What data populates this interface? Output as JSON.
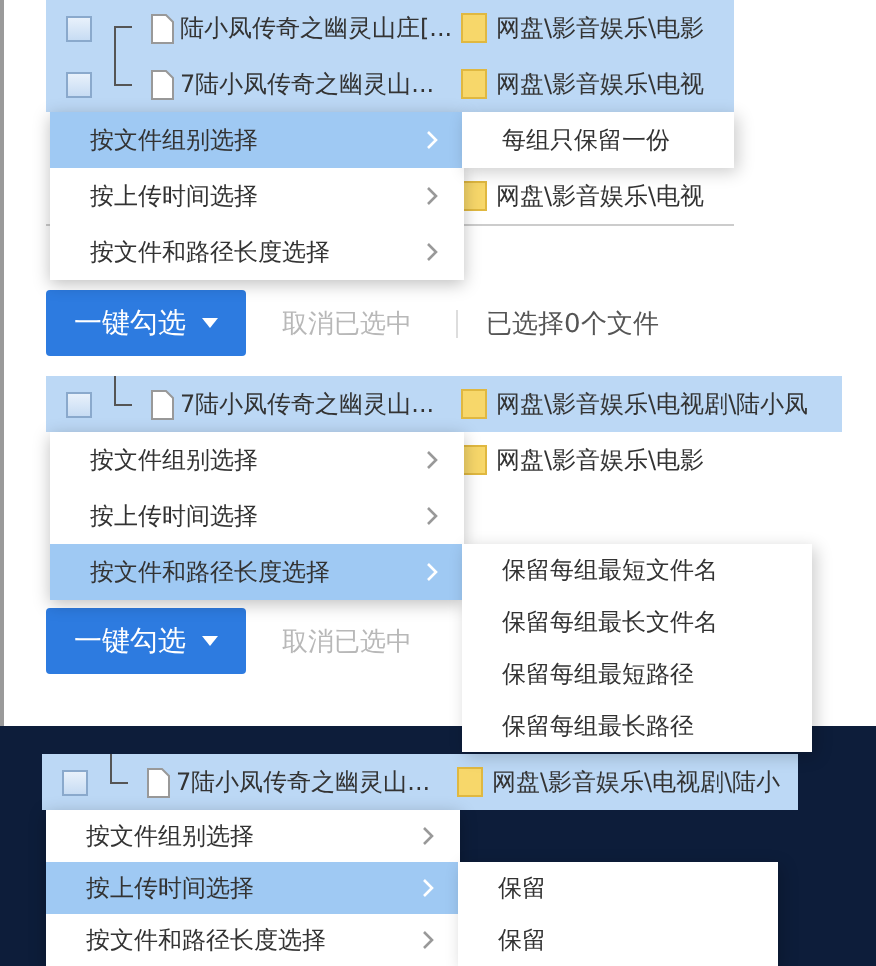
{
  "panels": [
    {
      "kind": "light",
      "rows": [
        {
          "selected": true,
          "kind": "tree-first",
          "file": "陆小凤传奇之幽灵山庄[...",
          "path": "网盘\\影音娱乐\\电影"
        },
        {
          "selected": true,
          "kind": "tree-last",
          "file": "7陆小凤传奇之幽灵山...",
          "path": "网盘\\影音娱乐\\电视"
        },
        {
          "selected": false,
          "kind": "plain",
          "path": "网盘\\影音娱乐\\电视"
        }
      ],
      "menu": {
        "items": [
          {
            "label": "按文件组别选择",
            "selected": true
          },
          {
            "label": "按上传时间选择",
            "selected": false
          },
          {
            "label": "按文件和路径长度选择",
            "selected": false
          }
        ],
        "submenu": [
          "每组只保留一份"
        ]
      },
      "footer": {
        "button": "一键勾选",
        "cancel": "取消已选中",
        "status": "已选择0个文件"
      }
    },
    {
      "kind": "light",
      "rows": [
        {
          "selected": true,
          "kind": "tree-last",
          "file": "7陆小凤传奇之幽灵山...",
          "path": "网盘\\影音娱乐\\电视剧\\陆小凤"
        },
        {
          "selected": false,
          "kind": "plain",
          "path": "网盘\\影音娱乐\\电影"
        }
      ],
      "menu": {
        "items": [
          {
            "label": "按文件组别选择",
            "selected": false
          },
          {
            "label": "按上传时间选择",
            "selected": false
          },
          {
            "label": "按文件和路径长度选择",
            "selected": true
          }
        ],
        "submenu": [
          "保留每组最短文件名",
          "保留每组最长文件名",
          "保留每组最短路径",
          "保留每组最长路径"
        ]
      },
      "footer": {
        "button": "一键勾选",
        "cancel": "取消已选中"
      }
    },
    {
      "kind": "dark",
      "rows": [
        {
          "selected": true,
          "kind": "tree-last",
          "file": "7陆小凤传奇之幽灵山...",
          "path": "网盘\\影音娱乐\\电视剧\\陆小"
        }
      ],
      "menu": {
        "items": [
          {
            "label": "按文件组别选择",
            "selected": false
          },
          {
            "label": "按上传时间选择",
            "selected": true
          },
          {
            "label": "按文件和路径长度选择",
            "selected": false
          }
        ],
        "submenu": [
          "保留",
          "保留"
        ]
      }
    }
  ]
}
